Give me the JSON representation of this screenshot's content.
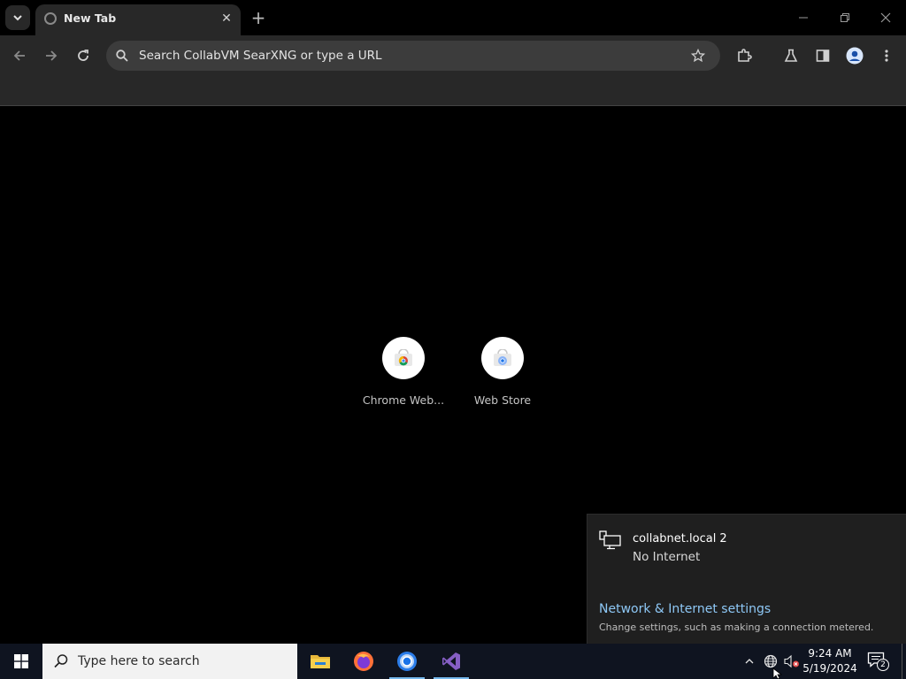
{
  "browser": {
    "tab": {
      "title": "New Tab"
    },
    "omnibox": {
      "placeholder": "Search CollabVM SearXNG or type a URL"
    }
  },
  "shortcuts": [
    {
      "label": "Chrome Web..."
    },
    {
      "label": "Web Store"
    }
  ],
  "network_flyout": {
    "network_name": "collabnet.local 2",
    "status": "No Internet",
    "settings_link": "Network & Internet settings",
    "settings_description": "Change settings, such as making a connection metered."
  },
  "taskbar": {
    "search_placeholder": "Type here to search",
    "clock": {
      "time": "9:24 AM",
      "date": "5/19/2024"
    },
    "notification_count": "2",
    "apps": [
      "file-explorer-icon",
      "firefox-icon",
      "chrome-icon",
      "visual-studio-icon"
    ]
  },
  "colors": {
    "browser_frame": "#000000",
    "toolbar": "#282828",
    "link": "#8ec8f6",
    "taskbar": "#0f1420"
  }
}
